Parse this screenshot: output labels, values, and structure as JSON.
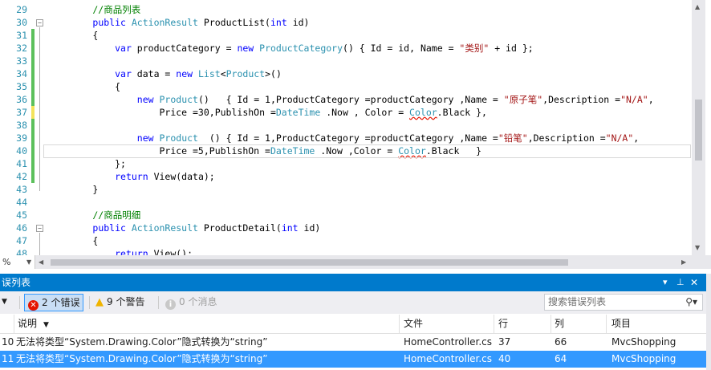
{
  "editor": {
    "line_numbers": [
      "29",
      "30",
      "31",
      "32",
      "33",
      "34",
      "35",
      "36",
      "37",
      "38",
      "39",
      "40",
      "41",
      "42",
      "43",
      "44",
      "45",
      "46",
      "47",
      "48"
    ],
    "lines": [
      [
        {
          "t": "        //商品列表",
          "c": "cm"
        }
      ],
      [
        {
          "t": "        "
        },
        {
          "t": "public",
          "c": "kw"
        },
        {
          "t": " "
        },
        {
          "t": "ActionResult",
          "c": "ty"
        },
        {
          "t": " ProductList("
        },
        {
          "t": "int",
          "c": "kw"
        },
        {
          "t": " id)"
        }
      ],
      [
        {
          "t": "        {"
        }
      ],
      [
        {
          "t": "            "
        },
        {
          "t": "var",
          "c": "kw"
        },
        {
          "t": " productCategory = "
        },
        {
          "t": "new",
          "c": "kw"
        },
        {
          "t": " "
        },
        {
          "t": "ProductCategory",
          "c": "ty"
        },
        {
          "t": "() { Id = id, Name = "
        },
        {
          "t": "\"类别\"",
          "c": "st"
        },
        {
          "t": " + id };"
        }
      ],
      [
        {
          "t": ""
        }
      ],
      [
        {
          "t": "            "
        },
        {
          "t": "var",
          "c": "kw"
        },
        {
          "t": " data = "
        },
        {
          "t": "new",
          "c": "kw"
        },
        {
          "t": " "
        },
        {
          "t": "List",
          "c": "ty"
        },
        {
          "t": "<"
        },
        {
          "t": "Product",
          "c": "ty"
        },
        {
          "t": ">()"
        }
      ],
      [
        {
          "t": "            {"
        }
      ],
      [
        {
          "t": "                "
        },
        {
          "t": "new",
          "c": "kw"
        },
        {
          "t": " "
        },
        {
          "t": "Product",
          "c": "ty"
        },
        {
          "t": "()   { Id = 1,ProductCategory =productCategory ,Name = "
        },
        {
          "t": "\"原子笔\"",
          "c": "st"
        },
        {
          "t": ",Description ="
        },
        {
          "t": "\"N/A\"",
          "c": "st"
        },
        {
          "t": ","
        }
      ],
      [
        {
          "t": "                    Price =30,PublishOn ="
        },
        {
          "t": "DateTime",
          "c": "ty"
        },
        {
          "t": " .Now , Color = "
        },
        {
          "t": "Color",
          "c": "ty err"
        },
        {
          "t": ".Black },"
        }
      ],
      [
        {
          "t": ""
        }
      ],
      [
        {
          "t": "                "
        },
        {
          "t": "new",
          "c": "kw"
        },
        {
          "t": " "
        },
        {
          "t": "Product",
          "c": "ty"
        },
        {
          "t": "  () { Id = 1,ProductCategory =productCategory ,Name ="
        },
        {
          "t": "\"铅笔\"",
          "c": "st"
        },
        {
          "t": ",Description ="
        },
        {
          "t": "\"N/A\"",
          "c": "st"
        },
        {
          "t": ","
        }
      ],
      [
        {
          "t": "                    Price =5,PublishOn ="
        },
        {
          "t": "DateTime",
          "c": "ty"
        },
        {
          "t": " .Now ,Color = "
        },
        {
          "t": "Color",
          "c": "ty err"
        },
        {
          "t": ".Black   }"
        }
      ],
      [
        {
          "t": "            };"
        }
      ],
      [
        {
          "t": "            "
        },
        {
          "t": "return",
          "c": "kw"
        },
        {
          "t": " View(data);"
        }
      ],
      [
        {
          "t": "        }"
        }
      ],
      [
        {
          "t": ""
        }
      ],
      [
        {
          "t": "        //商品明细",
          "c": "cm"
        }
      ],
      [
        {
          "t": "        "
        },
        {
          "t": "public",
          "c": "kw"
        },
        {
          "t": " "
        },
        {
          "t": "ActionResult",
          "c": "ty"
        },
        {
          "t": " ProductDetail("
        },
        {
          "t": "int",
          "c": "kw"
        },
        {
          "t": " id)"
        }
      ],
      [
        {
          "t": "        {"
        }
      ],
      [
        {
          "t": "            "
        },
        {
          "t": "return",
          "c": "kw"
        },
        {
          "t": " View();"
        }
      ]
    ],
    "zoom": "%"
  },
  "error_list": {
    "title": "误列表",
    "filter_arrow": "▼",
    "errors_btn": "2 个错误",
    "warnings_btn": "9 个警告",
    "messages_btn": "0 个消息",
    "search_placeholder": "搜索错误列表",
    "columns": {
      "desc": "说明",
      "file": "文件",
      "line": "行",
      "col": "列",
      "project": "项目"
    },
    "rows": [
      {
        "num": "10",
        "desc": "无法将类型“System.Drawing.Color”隐式转换为“string”",
        "file": "HomeController.cs",
        "line": "37",
        "col": "66",
        "project": "MvcShopping",
        "selected": false
      },
      {
        "num": "11",
        "desc": "无法将类型“System.Drawing.Color”隐式转换为“string”",
        "file": "HomeController.cs",
        "line": "40",
        "col": "64",
        "project": "MvcShopping",
        "selected": true
      }
    ]
  },
  "colors": {
    "accent": "#007acc",
    "selection": "#3399ff",
    "error": "#e51400",
    "warning": "#f0b400"
  }
}
